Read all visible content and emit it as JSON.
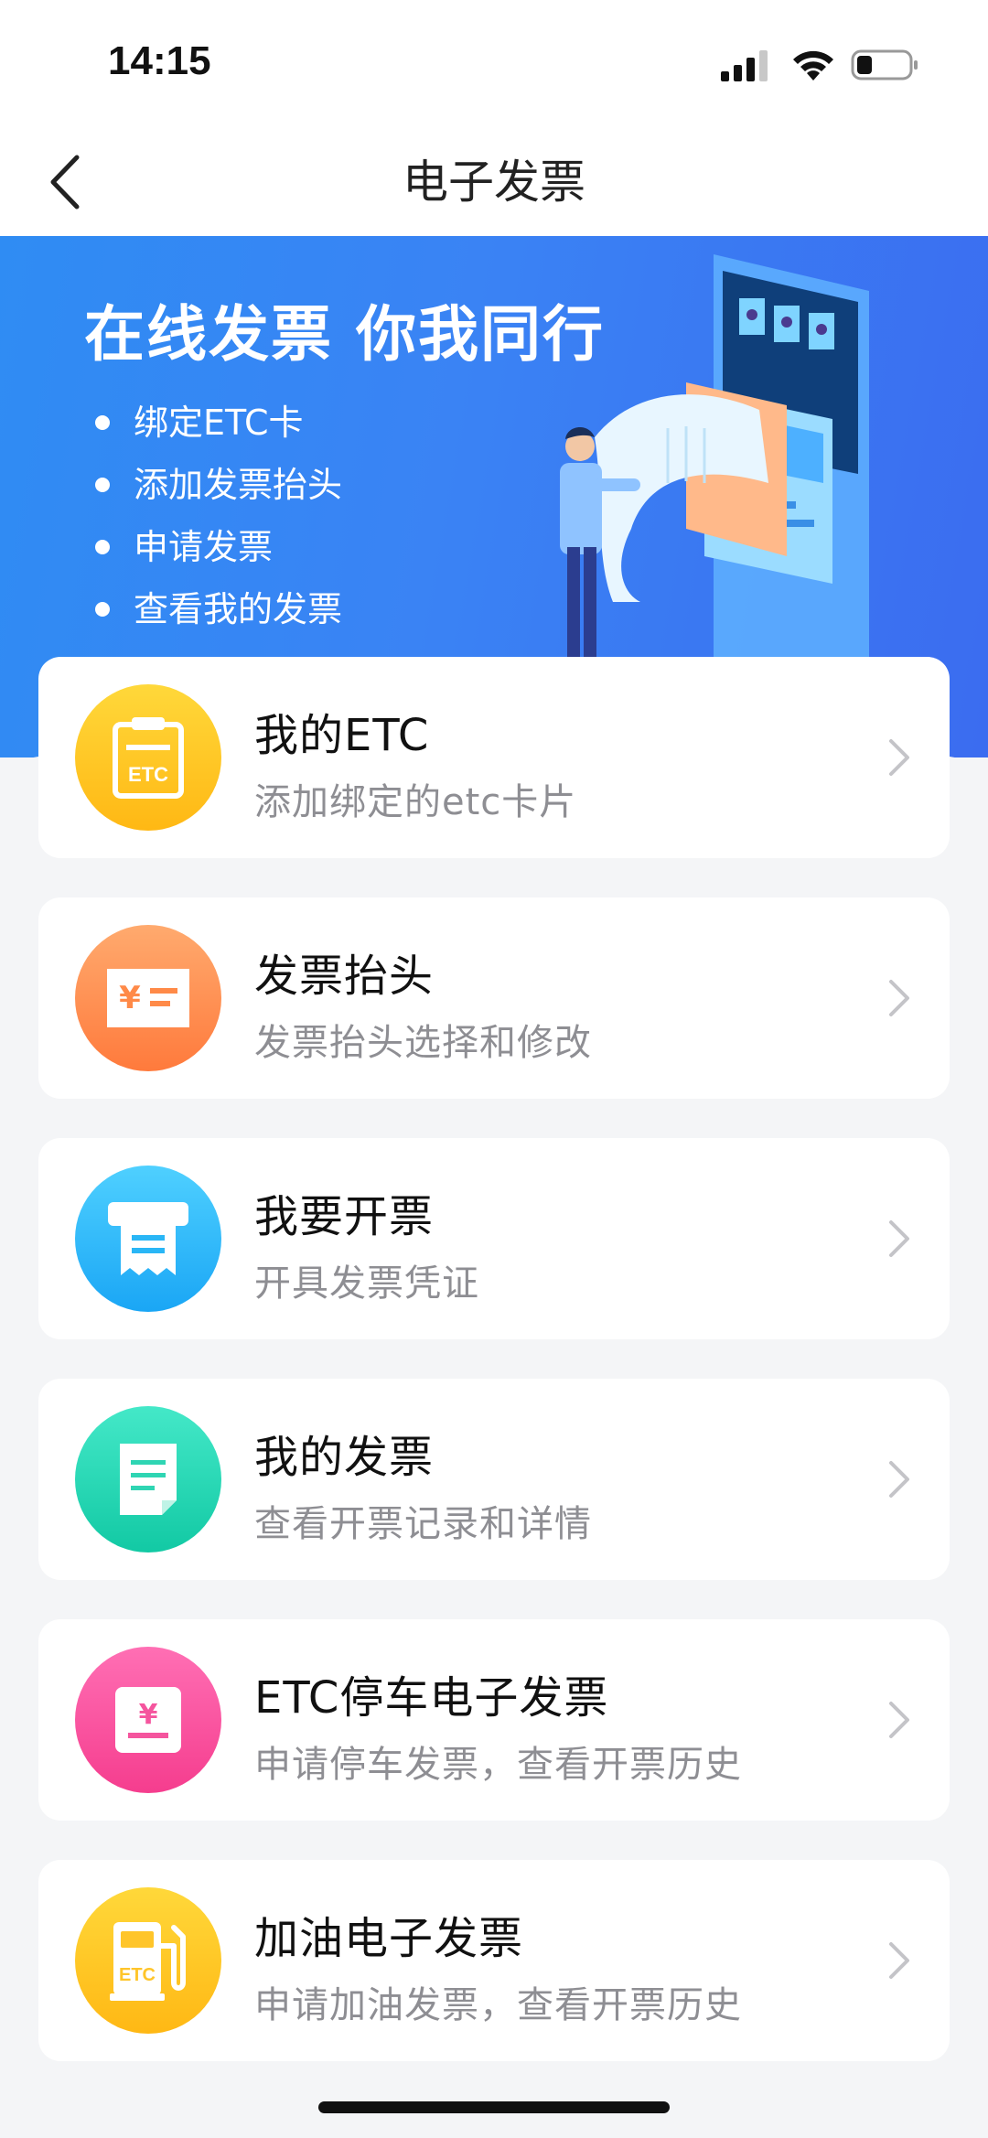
{
  "status_bar": {
    "time": "14:15"
  },
  "header": {
    "title": "电子发票"
  },
  "banner": {
    "headline": "在线发票 你我同行",
    "items": [
      "绑定ETC卡",
      "添加发票抬头",
      "申请发票",
      "查看我的发票"
    ]
  },
  "menu": [
    {
      "title": "我的ETC",
      "subtitle": "添加绑定的etc卡片",
      "icon": "etc-card-icon",
      "color_top": "#ffd83a",
      "color_bottom": "#ffb814"
    },
    {
      "title": "发票抬头",
      "subtitle": "发票抬头选择和修改",
      "icon": "invoice-header-icon",
      "color_top": "#ffaa6e",
      "color_bottom": "#ff7a3c"
    },
    {
      "title": "我要开票",
      "subtitle": "开具发票凭证",
      "icon": "print-invoice-icon",
      "color_top": "#4fd0ff",
      "color_bottom": "#1aa6f5"
    },
    {
      "title": "我的发票",
      "subtitle": "查看开票记录和详情",
      "icon": "document-icon",
      "color_top": "#44e8c8",
      "color_bottom": "#12c9a4"
    },
    {
      "title": "ETC停车电子发票",
      "subtitle": "申请停车发票，查看开票历史",
      "icon": "parking-invoice-icon",
      "color_top": "#ff6fb4",
      "color_bottom": "#f53d8e"
    },
    {
      "title": "加油电子发票",
      "subtitle": "申请加油发票，查看开票历史",
      "icon": "fuel-pump-icon",
      "color_top": "#ffd83a",
      "color_bottom": "#ffb814"
    }
  ]
}
